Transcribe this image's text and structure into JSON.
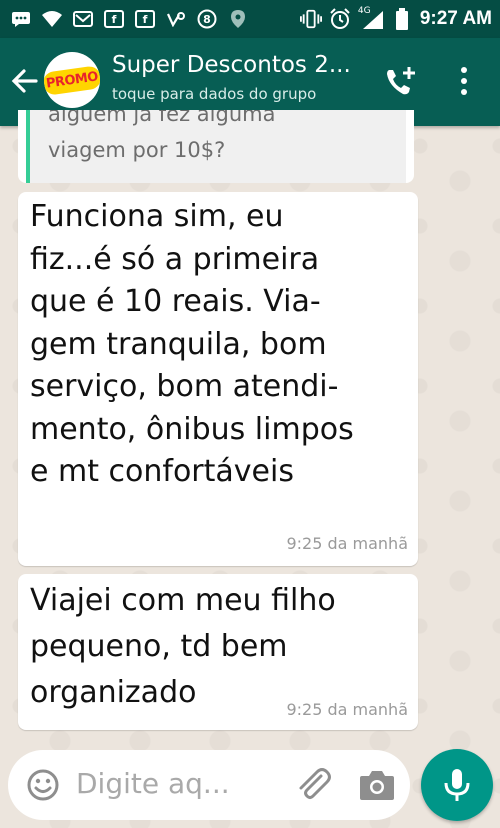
{
  "status_bar": {
    "time": "9:27 AM",
    "network": "4G",
    "icons": [
      "message-icon",
      "wifi-icon",
      "mail-icon",
      "facebook-icon",
      "facebook-icon",
      "vine-icon",
      "badge-icon",
      "location-icon",
      "vibrate-icon",
      "alarm-icon",
      "signal-icon",
      "battery-icon"
    ]
  },
  "header": {
    "title": "Super Descontos 2...",
    "subtitle": "toque para dados do grupo",
    "avatar_text": "PROMO"
  },
  "messages": [
    {
      "type": "quote",
      "lines": [
        "alguém já fez alguma",
        "viagem por 10$?"
      ]
    },
    {
      "type": "text",
      "lines": [
        "Funciona sim, eu",
        "fiz...é só a primeira",
        "que é 10 reais. Via-",
        "gem tranquila, bom",
        "serviço, bom atendi-",
        "mento, ônibus limpos",
        "e mt confortáveis"
      ],
      "time": "9:25 da manhã"
    },
    {
      "type": "text",
      "lines": [
        "Viajei com meu filho",
        "pequeno, td bem",
        "organizado"
      ],
      "time": "9:25 da manhã"
    }
  ],
  "composer": {
    "placeholder": "Digite aq..."
  },
  "colors": {
    "status_bar": "#054d44",
    "app_bar": "#075e54",
    "accent": "#009688",
    "quote_bar": "#35cd96",
    "chat_bg": "#ece5dd"
  }
}
